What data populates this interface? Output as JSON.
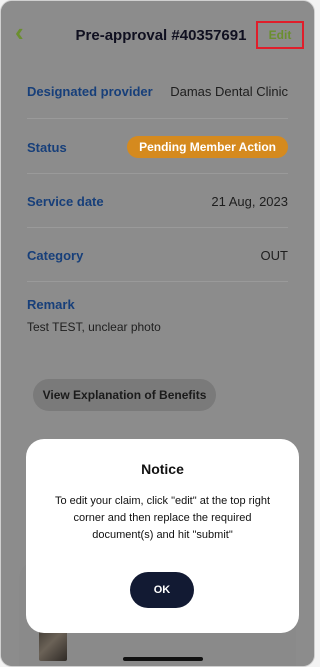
{
  "header": {
    "title": "Pre-approval #40357691",
    "edit_label": "Edit",
    "back_icon": "chevron-left-icon"
  },
  "details": {
    "designated_provider_label": "Designated provider",
    "designated_provider_value": "Damas Dental Clinic",
    "status_label": "Status",
    "status_value": "Pending Member Action",
    "service_date_label": "Service date",
    "service_date_value": "21 Aug, 2023",
    "category_label": "Category",
    "category_value": "OUT",
    "remark_label": "Remark",
    "remark_value": "Test TEST, unclear photo"
  },
  "actions": {
    "eob_label": "View Explanation of Benefits"
  },
  "modal": {
    "title": "Notice",
    "body": "To edit your claim, click \"edit\" at the top right corner and then replace the required document(s) and hit \"submit\"",
    "ok_label": "OK"
  },
  "colors": {
    "accent_green": "#6b8f2f",
    "label_blue": "#173f7a",
    "status_orange": "#d58a1e",
    "dark_button": "#121a33",
    "highlight_red": "#e01e2b"
  }
}
